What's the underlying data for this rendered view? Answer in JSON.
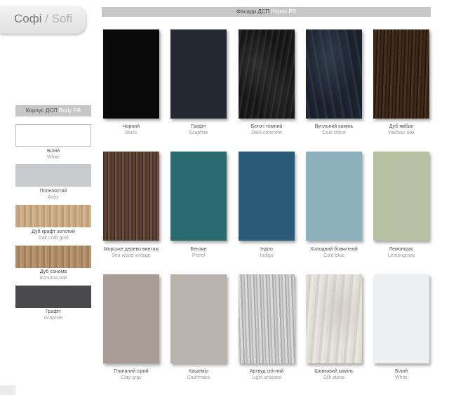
{
  "title": {
    "uk": "Софі",
    "sep": "/",
    "en": "Sofi"
  },
  "fronts_header": {
    "uk": "Фасади ДСП",
    "en": "Fronts PB"
  },
  "body_header": {
    "uk": "Корпус ДСП",
    "en": "Body PB"
  },
  "body_colors": [
    {
      "uk": "Білий",
      "en": "White"
    },
    {
      "uk": "Попелястий",
      "en": "Ashy"
    },
    {
      "uk": "Дуб крафт золотий",
      "en": "Oak craft gold"
    },
    {
      "uk": "Дуб сонома",
      "en": "Sonoma oak"
    },
    {
      "uk": "Графіт",
      "en": "Graphite"
    }
  ],
  "front_colors": [
    {
      "uk": "Чорний",
      "en": "Black"
    },
    {
      "uk": "Графіт",
      "en": "Graphite"
    },
    {
      "uk": "Бетон темний",
      "en": "Dark concrete"
    },
    {
      "uk": "Вугільний камінь",
      "en": "Coal stone"
    },
    {
      "uk": "Дуб якібан",
      "en": "Yakiban oak"
    },
    {
      "uk": "Морське дерево винтаж",
      "en": "Sea wood vintage"
    },
    {
      "uk": "Бензин",
      "en": "Petrol"
    },
    {
      "uk": "Індіго",
      "en": "Indigo"
    },
    {
      "uk": "Холодний блакитний",
      "en": "Cold blue"
    },
    {
      "uk": "Лемонграс",
      "en": "Lemongrass"
    },
    {
      "uk": "Глиняний сірий",
      "en": "Clay gray"
    },
    {
      "uk": "Кашемір",
      "en": "Cashmere"
    },
    {
      "uk": "Артвуд світлий",
      "en": "Light artwood"
    },
    {
      "uk": "Шовковий камінь",
      "en": "Silk stone"
    },
    {
      "uk": "Білий",
      "en": "White"
    }
  ]
}
